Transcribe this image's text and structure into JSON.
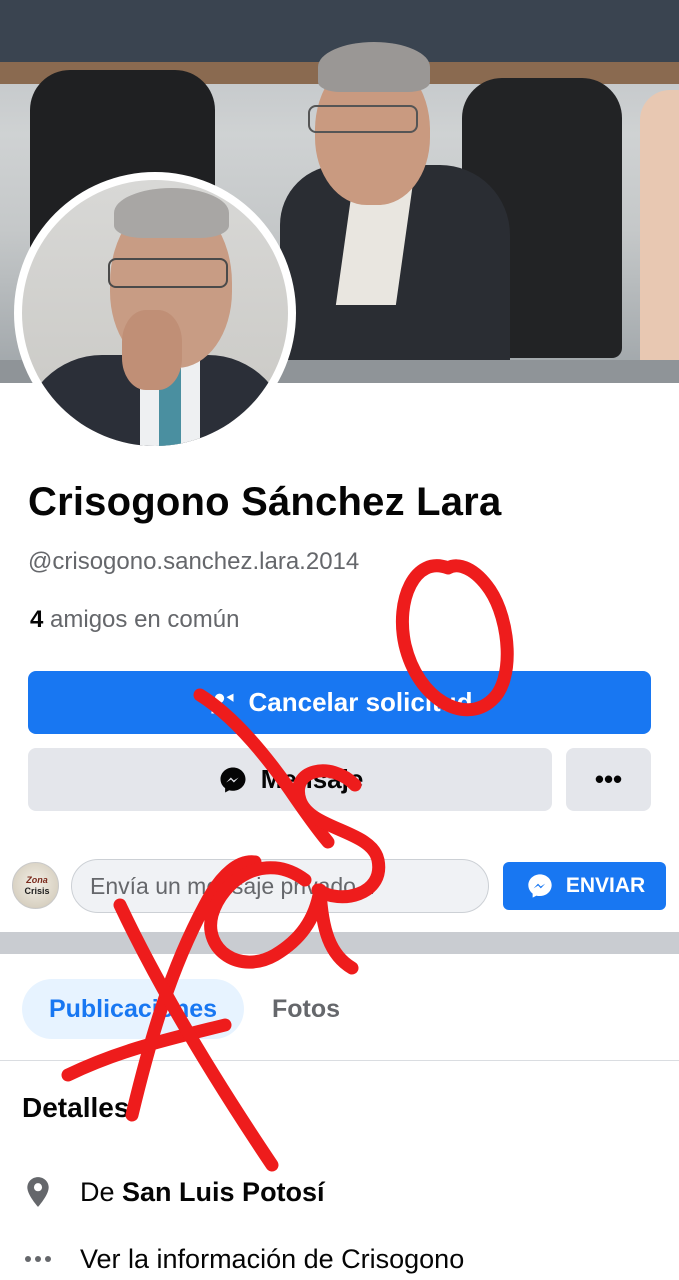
{
  "profile": {
    "name": "Crisogono Sánchez Lara",
    "username": "@crisogono.sanchez.lara.2014",
    "mutual_count": "4",
    "mutual_label": "amigos en común"
  },
  "actions": {
    "primary_label": "Cancelar solicitud",
    "message_label": "Mensaje",
    "more_label": "•••"
  },
  "composer": {
    "avatar_line1": "Zona",
    "avatar_line2": "Crisis",
    "placeholder": "Envía un mensaje privado...",
    "send_label": "ENVIAR"
  },
  "tabs": [
    {
      "label": "Publicaciones",
      "active": true
    },
    {
      "label": "Fotos",
      "active": false
    }
  ],
  "details": {
    "title": "Detalles",
    "location_prefix": "De",
    "location": "San Luis Potosí",
    "more_info": "Ver la información de Crisogono"
  },
  "overlay_text": "falso",
  "colors": {
    "accent": "#1877f2",
    "overlay": "#ee1c1c",
    "secondary_button": "#e4e6eb"
  },
  "icons": {
    "primary_button": "friend-request-sent-icon",
    "message_button": "messenger-icon",
    "send_button": "messenger-icon",
    "location": "location-pin-icon",
    "more_info": "ellipsis-icon"
  }
}
